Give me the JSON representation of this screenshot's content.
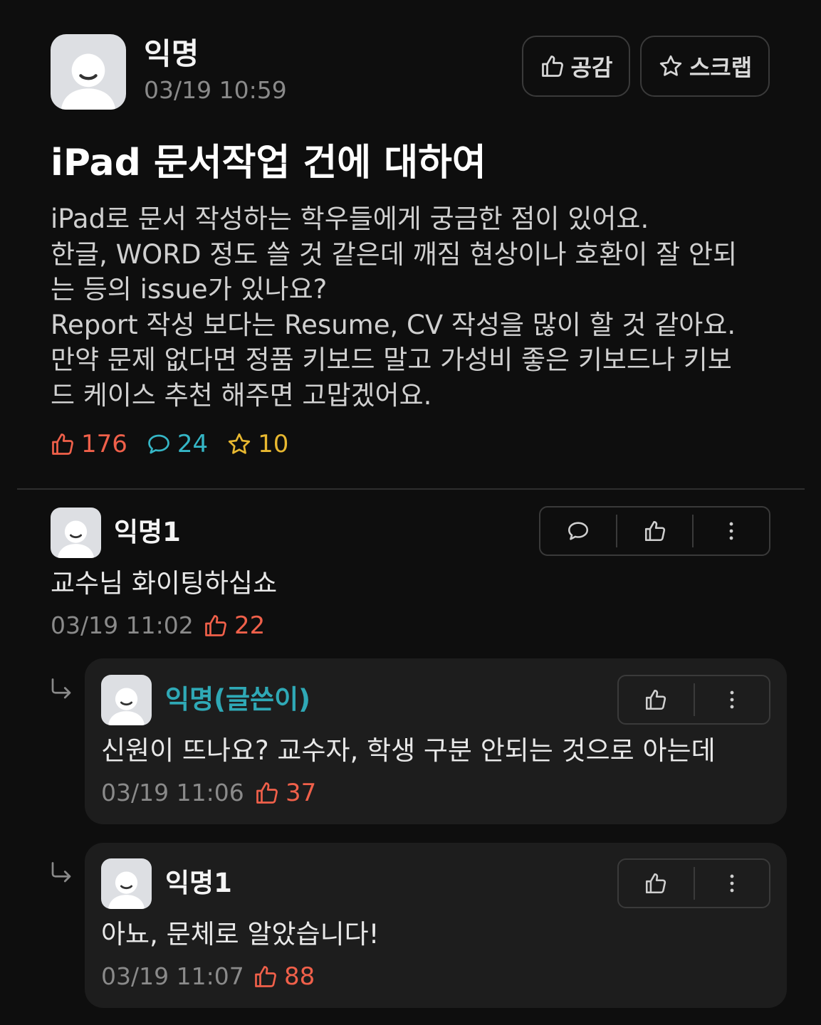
{
  "post": {
    "author": "익명",
    "time": "03/19 10:59",
    "buttons": {
      "empathy": "공감",
      "scrap": "스크랩"
    },
    "title": "iPad 문서작업 건에 대하여",
    "body_lines": [
      "iPad로 문서 작성하는 학우들에게 궁금한 점이 있어요.",
      "한글, WORD 정도 쓸 것 같은데 깨짐 현상이나 호환이 잘 안되",
      "는 등의 issue가 있나요?",
      "Report 작성 보다는 Resume, CV 작성을 많이 할 것 같아요.",
      "만약 문제 없다면 정품 키보드 말고 가성비 좋은 키보드나 키보",
      "드 케이스 추천 해주면 고맙겠어요."
    ],
    "stats": {
      "likes": "176",
      "comments": "24",
      "scraps": "10"
    }
  },
  "comments": [
    {
      "author": "익명1",
      "text": "교수님 화이팅하십쇼",
      "time": "03/19 11:02",
      "likes": "22"
    }
  ],
  "replies": [
    {
      "author": "익명(글쓴이)",
      "text": "신원이 뜨나요? 교수자, 학생 구분 안되는 것으로 아는데",
      "time": "03/19 11:06",
      "likes": "37"
    },
    {
      "author": "익명1",
      "text": "아뇨, 문체로 알았습니다!",
      "time": "03/19 11:07",
      "likes": "88"
    }
  ],
  "colors": {
    "background": "#0e0e0e",
    "like": "#f0604a",
    "comment": "#35b6c6",
    "scrap": "#e8b830",
    "writer": "#2fa9b6",
    "reply_bg": "#1d1d1d"
  },
  "icons": [
    "thumbs-up-icon",
    "star-icon",
    "speech-bubble-icon",
    "more-vertical-icon",
    "reply-arrow-icon",
    "avatar-icon"
  ]
}
